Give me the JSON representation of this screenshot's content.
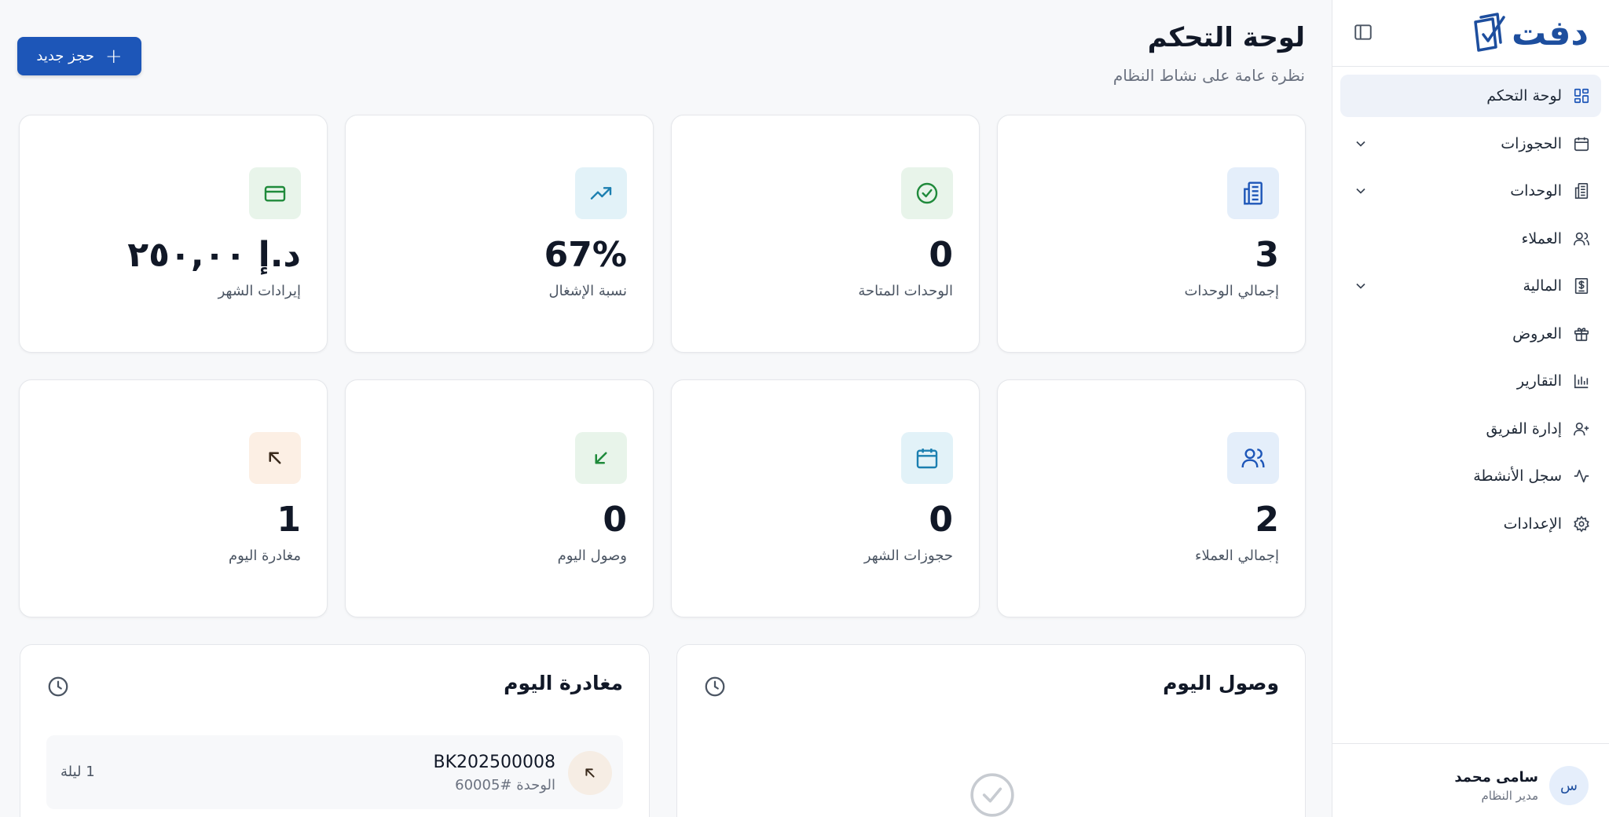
{
  "brand": {
    "name": "دفت"
  },
  "sidebar": {
    "items": [
      {
        "label": "لوحة التحكم",
        "icon": "dashboard-icon",
        "active": true,
        "expandable": false
      },
      {
        "label": "الحجوزات",
        "icon": "calendar-icon",
        "active": false,
        "expandable": true
      },
      {
        "label": "الوحدات",
        "icon": "building-icon",
        "active": false,
        "expandable": true
      },
      {
        "label": "العملاء",
        "icon": "users-icon",
        "active": false,
        "expandable": false
      },
      {
        "label": "المالية",
        "icon": "dollar-document-icon",
        "active": false,
        "expandable": true
      },
      {
        "label": "العروض",
        "icon": "gift-icon",
        "active": false,
        "expandable": false
      },
      {
        "label": "التقارير",
        "icon": "bar-chart-icon",
        "active": false,
        "expandable": false
      },
      {
        "label": "إدارة الفريق",
        "icon": "user-plus-icon",
        "active": false,
        "expandable": false
      },
      {
        "label": "سجل الأنشطة",
        "icon": "activity-icon",
        "active": false,
        "expandable": false
      },
      {
        "label": "الإعدادات",
        "icon": "gear-icon",
        "active": false,
        "expandable": false
      }
    ]
  },
  "user": {
    "initial": "س",
    "name": "سامى محمد",
    "role": "مدير النظام"
  },
  "header": {
    "title": "لوحة التحكم",
    "subtitle": "نظرة عامة على نشاط النظام",
    "new_booking_label": "حجز جديد"
  },
  "stats": [
    {
      "value": "3",
      "label": "إجمالي الوحدات",
      "icon": "building-icon",
      "icon_bg": "#e4eefa",
      "icon_color": "#1d56b8"
    },
    {
      "value": "0",
      "label": "الوحدات المتاحة",
      "icon": "check-circle-icon",
      "icon_bg": "#e8f4ea",
      "icon_color": "#1f8a3b"
    },
    {
      "value": "67%",
      "label": "نسبة الإشغال",
      "icon": "trending-up-icon",
      "icon_bg": "#e2f2f8",
      "icon_color": "#1b7fb0"
    },
    {
      "value": "د.إ ٢٥٠,٠٠",
      "label": "إيرادات الشهر",
      "icon": "credit-card-icon",
      "icon_bg": "#e8f4ea",
      "icon_color": "#1f8a3b"
    },
    {
      "value": "2",
      "label": "إجمالي العملاء",
      "icon": "users-icon",
      "icon_bg": "#e4eefa",
      "icon_color": "#1d56b8"
    },
    {
      "value": "0",
      "label": "حجوزات الشهر",
      "icon": "calendar-icon",
      "icon_bg": "#e2f2f8",
      "icon_color": "#1b7fb0"
    },
    {
      "value": "0",
      "label": "وصول اليوم",
      "icon": "arrow-down-left-icon",
      "icon_bg": "#e8f4ea",
      "icon_color": "#1f8a3b"
    },
    {
      "value": "1",
      "label": "مغادرة اليوم",
      "icon": "arrow-up-left-icon",
      "icon_bg": "#fcefe4",
      "icon_color": "#3a2a1c"
    }
  ],
  "arrivals": {
    "title": "وصول اليوم"
  },
  "departures": {
    "title": "مغادرة اليوم",
    "items": [
      {
        "code": "BK202500008",
        "unit": "الوحدة #60005",
        "nights": "1 ليلة"
      }
    ]
  }
}
